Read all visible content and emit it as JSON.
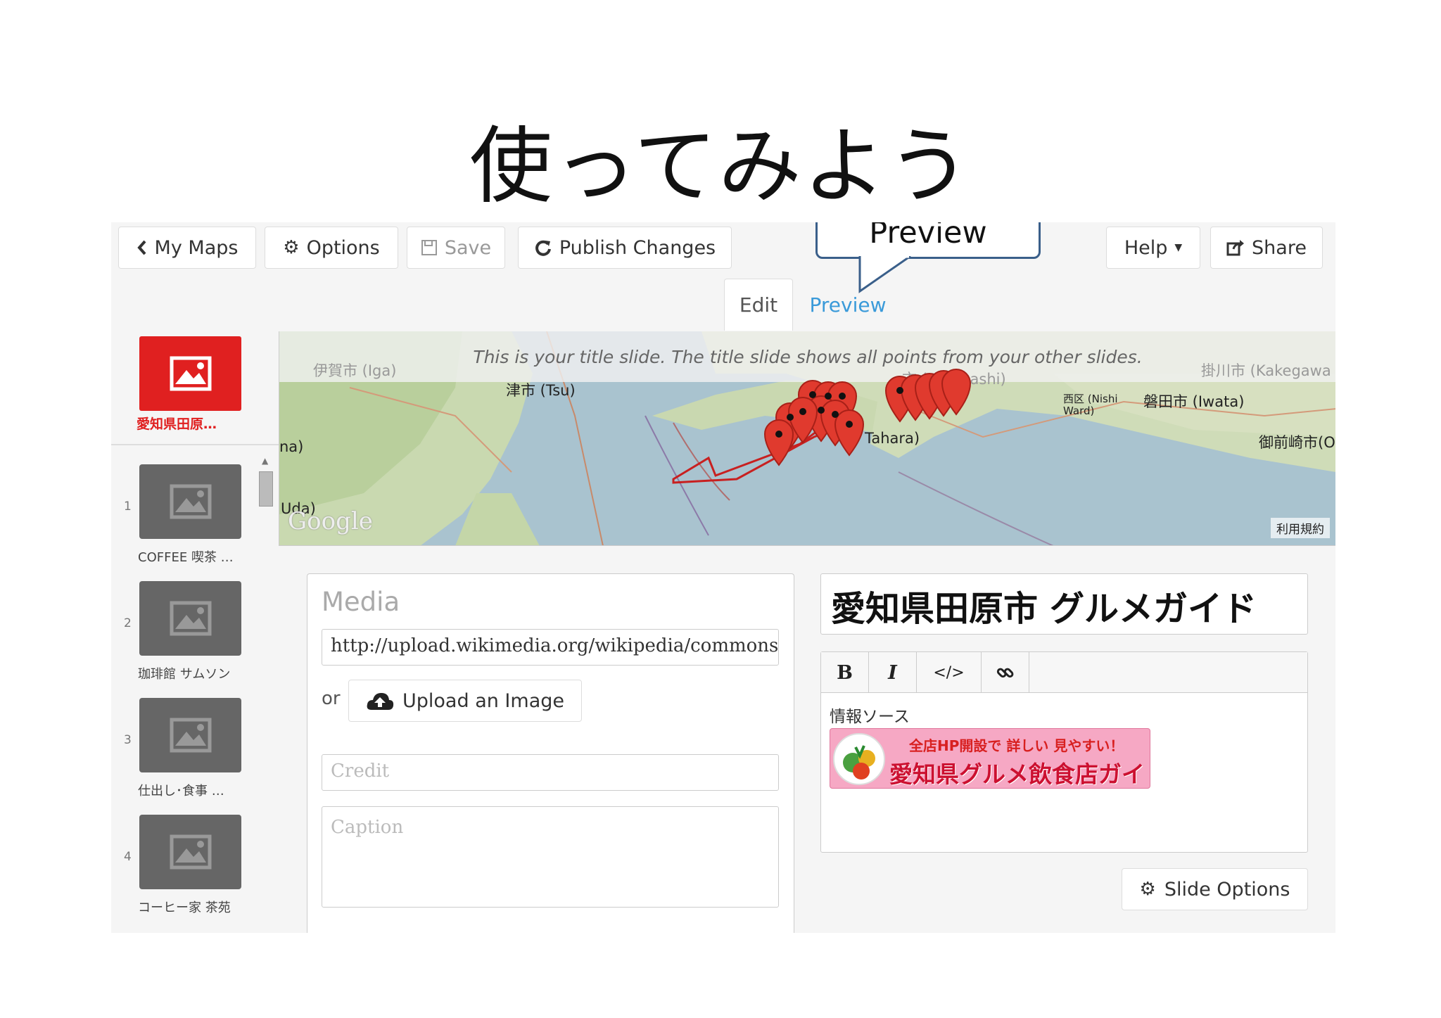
{
  "slide_title": "使ってみよう",
  "toolbar": {
    "my_maps": "My Maps",
    "options": "Options",
    "save": "Save",
    "publish": "Publish Changes",
    "help": "Help",
    "share": "Share"
  },
  "callout": "Preview",
  "tabs": {
    "edit": "Edit",
    "preview": "Preview"
  },
  "sidebar": {
    "title_slide_label": "愛知県田原…",
    "slides": [
      {
        "num": "1",
        "label": "COFFEE 喫茶 …"
      },
      {
        "num": "2",
        "label": "珈琲館 サムソン"
      },
      {
        "num": "3",
        "label": "仕出し･食事 …"
      },
      {
        "num": "4",
        "label": "コーヒー家 茶苑"
      }
    ]
  },
  "map": {
    "note": "This is your title slide. The title slide shows all points from your other slides.",
    "labels": {
      "iga": "伊賀市 (Iga)",
      "tsu": "津市 (Tsu)",
      "toyohashi": "市 (Toyohashi)",
      "nishi": "西区 (Nishi Ward)",
      "iwata": "磐田市 (Iwata)",
      "kakegawa": "掛川市 (Kakegawa",
      "omaezaki": "御前崎市(O",
      "tahara": "Tahara)",
      "na": "na)",
      "uda": "Uda)"
    },
    "google": "Google",
    "terms": "利用規約",
    "marker_color": "#e03a2e"
  },
  "media": {
    "heading": "Media",
    "url_value": "http://upload.wikimedia.org/wikipedia/commons",
    "or": "or",
    "upload_label": "Upload an Image",
    "credit_placeholder": "Credit",
    "caption_placeholder": "Caption"
  },
  "headline": "愛知県田原市 グルメガイド",
  "editor": {
    "bold": "B",
    "italic": "I",
    "code": "</>",
    "link_icon": "link-icon",
    "text": "情報ソース",
    "banner_small": "全店HP開設で 詳しい 見やすい！",
    "banner_large": "愛知県グルメ飲食店ガイド"
  },
  "slide_options": "Slide Options",
  "colors": {
    "accent": "#e02020",
    "link": "#3a9ad9",
    "callout_border": "#3a5f8a"
  }
}
